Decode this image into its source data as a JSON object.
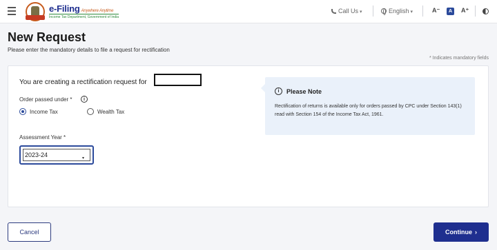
{
  "header": {
    "brand_main": "e-Filing",
    "brand_tag": "Anywhere Anytime",
    "brand_sub": "Income Tax Department, Government of India",
    "call_us": "Call Us",
    "language": "English",
    "font_decrease": "A⁻",
    "font_normal": "A",
    "font_increase": "A⁺"
  },
  "page": {
    "title": "New Request",
    "subtitle": "Please enter the mandatory details to file a request for rectification",
    "mandatory_note": "* Indicates mandatory fields"
  },
  "form": {
    "heading": "You are creating a rectification request for",
    "order_label": "Order passed under *",
    "info_glyph": "i",
    "radios": [
      {
        "label": "Income Tax",
        "checked": true
      },
      {
        "label": "Wealth Tax",
        "checked": false
      }
    ],
    "ay_label": "Assessment Year *",
    "ay_value": "2023-24",
    "caret": "▾"
  },
  "note": {
    "icon_glyph": "i",
    "title": "Please Note",
    "text": "Rectification of returns is available only for orders passed by CPC under Section 143(1) read with Section 154 of the Income Tax Act, 1961."
  },
  "footer": {
    "cancel_label": "Cancel",
    "continue_label": "Continue",
    "continue_chevron": "›"
  },
  "icons": {
    "menu": "hamburger-icon",
    "phone": "phone-icon",
    "globe": "globe-icon",
    "contrast": "contrast-icon",
    "info": "info-icon"
  },
  "colors": {
    "primary": "#1f2f8f",
    "accent": "#2b4a9b",
    "note_bg": "#eaf1fa",
    "page_bg": "#f4f5f8"
  }
}
